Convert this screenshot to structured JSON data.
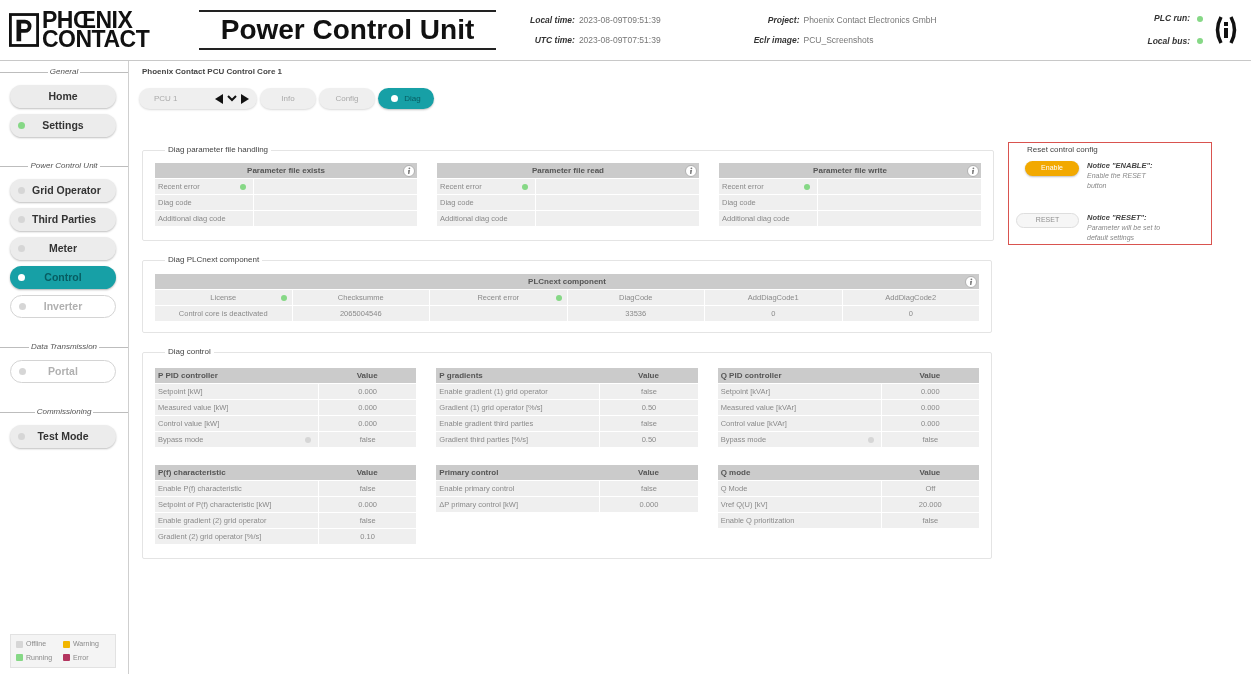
{
  "header": {
    "logo": "PHŒNIX CONTACT",
    "title": "Power Control Unit",
    "times": [
      {
        "label": "Local time:",
        "value": "2023-08-09T09:51:39"
      },
      {
        "label": "UTC time:",
        "value": "2023-08-09T07:51:39"
      }
    ],
    "project": [
      {
        "label": "Project:",
        "value": "Phoenix Contact Electronics GmbH"
      },
      {
        "label": "Eclr image:",
        "value": "PCU_Screenshots"
      }
    ],
    "status": [
      {
        "label": "PLC run:",
        "color": "#86d886"
      },
      {
        "label": "Local bus:",
        "color": "#86d886"
      }
    ]
  },
  "sidebar": {
    "sections": [
      {
        "title": "General",
        "items": [
          {
            "label": "Home",
            "selected": false,
            "disabled": false
          },
          {
            "label": "Settings",
            "color": "#86d886",
            "selected": false,
            "disabled": false
          }
        ]
      },
      {
        "title": "Power Control Unit",
        "items": [
          {
            "label": "Grid Operator",
            "color": "#d6d6d6",
            "selected": false,
            "disabled": false
          },
          {
            "label": "Third Parties",
            "color": "#d6d6d6",
            "selected": false,
            "disabled": false
          },
          {
            "label": "Meter",
            "color": "#d6d6d6",
            "selected": false,
            "disabled": false
          },
          {
            "label": "Control",
            "color": "#ffffff",
            "selected": true,
            "disabled": false
          },
          {
            "label": "Inverter",
            "color": "#d6d6d6",
            "selected": false,
            "disabled": true
          }
        ]
      },
      {
        "title": "Data Transmission",
        "items": [
          {
            "label": "Portal",
            "color": "#d6d6d6",
            "selected": false,
            "disabled": true
          }
        ]
      },
      {
        "title": "Commissioning",
        "items": [
          {
            "label": "Test Mode",
            "color": "#d6d6d6",
            "selected": false,
            "disabled": false
          }
        ]
      }
    ],
    "legend": [
      {
        "label": "Offline",
        "color": "#d6d6d6"
      },
      {
        "label": "Warning",
        "color": "#f2b600"
      },
      {
        "label": "Running",
        "color": "#86d886"
      },
      {
        "label": "Error",
        "color": "#b3355f"
      }
    ]
  },
  "main": {
    "title": "Phoenix Contact PCU Control Core 1",
    "tabs": [
      {
        "kind": "selector",
        "label": "PCU 1",
        "selected": false
      },
      {
        "kind": "tab",
        "label": "Info",
        "selected": false
      },
      {
        "kind": "tab",
        "label": "Config",
        "selected": false
      },
      {
        "kind": "tab",
        "label": "Diag",
        "selected": true
      }
    ],
    "file_handling": {
      "title": "Diag parameter file handling",
      "tables": [
        {
          "title": "Parameter file exists",
          "rows": [
            {
              "label": "Recent error",
              "color": "#86d886"
            },
            {
              "label": "Diag code"
            },
            {
              "label": "Additional diag code"
            }
          ]
        },
        {
          "title": "Parameter file read",
          "rows": [
            {
              "label": "Recent error",
              "color": "#86d886"
            },
            {
              "label": "Diag code"
            },
            {
              "label": "Additional diag code"
            }
          ]
        },
        {
          "title": "Parameter file write",
          "rows": [
            {
              "label": "Recent error",
              "color": "#86d886"
            },
            {
              "label": "Diag code"
            },
            {
              "label": "Additional diag code"
            }
          ]
        }
      ]
    },
    "reset": {
      "title": "Reset control config",
      "items": [
        {
          "button": "Enable",
          "disabled": false,
          "notice": "Notice \"ENABLE\":",
          "text": "Enable the RESET button"
        },
        {
          "button": "RESET",
          "disabled": true,
          "notice": "Notice \"RESET\":",
          "text": "Parameter will be set to default settings"
        }
      ]
    },
    "plcnext": {
      "title": "Diag PLCnext component",
      "table": {
        "title": "PLCnext component",
        "columns": [
          {
            "label": "License",
            "color": "#86d886",
            "value": "Control core is deactivated"
          },
          {
            "label": "Checksumme",
            "value": "2065004546"
          },
          {
            "label": "Recent error",
            "color": "#86d886"
          },
          {
            "label": "DiagCode",
            "value": "33536"
          },
          {
            "label": "AddDiagCode1",
            "value": "0"
          },
          {
            "label": "AddDiagCode2",
            "value": "0"
          }
        ]
      }
    },
    "diag_control": {
      "title": "Diag control",
      "tables": [
        {
          "title": "P PID controller",
          "value_heading": "Value",
          "rows": [
            {
              "label": "Setpoint [kW]",
              "value": "0.000"
            },
            {
              "label": "Measured value [kW]",
              "value": "0.000"
            },
            {
              "label": "Control value [kW]",
              "value": "0.000"
            },
            {
              "label": "Bypass mode",
              "color": "#d6d6d6",
              "value": "false"
            }
          ]
        },
        {
          "title": "P gradients",
          "value_heading": "Value",
          "rows": [
            {
              "label": "Enable gradient (1) grid operator",
              "value": "false"
            },
            {
              "label": "Gradient (1) grid operator [%/s]",
              "value": "0.50"
            },
            {
              "label": "Enable gradient third parties",
              "value": "false"
            },
            {
              "label": "Gradient third parties [%/s]",
              "value": "0.50"
            }
          ]
        },
        {
          "title": "Q PID controller",
          "value_heading": "Value",
          "rows": [
            {
              "label": "Setpoint [kVAr]",
              "value": "0.000"
            },
            {
              "label": "Measured value [kVAr]",
              "value": "0.000"
            },
            {
              "label": "Control value [kVAr]",
              "value": "0.000"
            },
            {
              "label": "Bypass mode",
              "color": "#d6d6d6",
              "value": "false"
            }
          ]
        },
        {
          "title": "P(f) characteristic",
          "value_heading": "Value",
          "rows": [
            {
              "label": "Enable P(f) characteristic",
              "value": "false"
            },
            {
              "label": "Setpoint of P(f) characteristic [kW]",
              "value": "0.000"
            },
            {
              "label": "Enable gradient (2) grid operator",
              "value": "false"
            },
            {
              "label": "Gradient (2) grid operator [%/s]",
              "value": "0.10"
            }
          ]
        },
        {
          "title": "Primary control",
          "value_heading": "Value",
          "rows": [
            {
              "label": "Enable primary control",
              "value": "false"
            },
            {
              "label": "ΔP primary control [kW]",
              "value": "0.000"
            }
          ]
        },
        {
          "title": "Q mode",
          "value_heading": "Value",
          "rows": [
            {
              "label": "Q Mode",
              "value": "Off"
            },
            {
              "label": "Vref Q(U) [kV]",
              "value": "20.000"
            },
            {
              "label": "Enable Q prioritization",
              "value": "false"
            }
          ]
        }
      ]
    }
  }
}
